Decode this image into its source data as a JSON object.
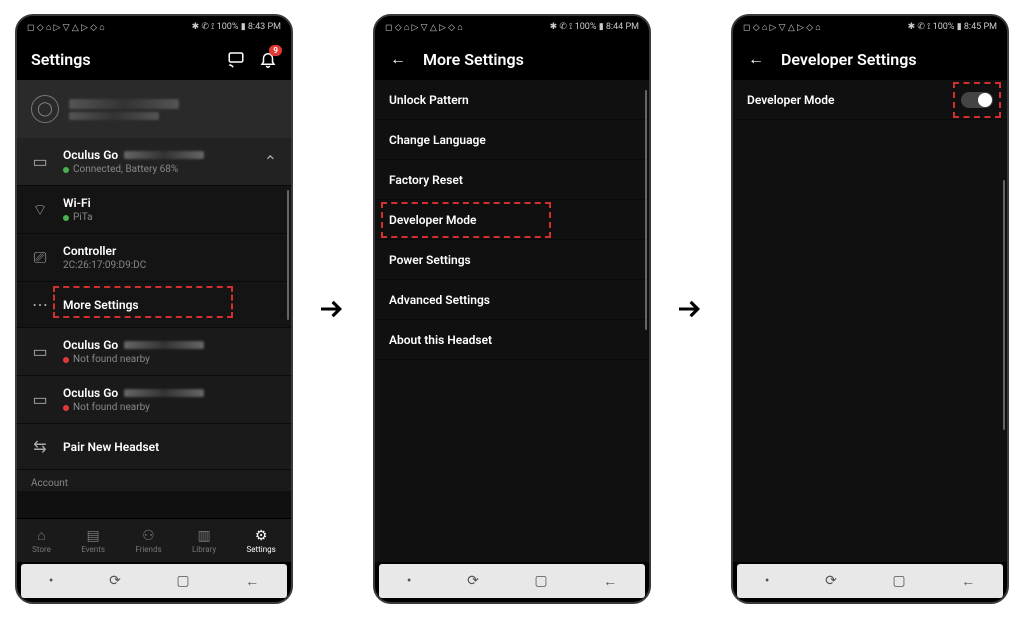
{
  "status": {
    "left_icons": "◻ ◇ ⌂ ▷ ▽ △ ▷ ◇ ⌂",
    "right1": "✱ ✆ ⟟ 100% ▮ 8:43 PM",
    "right2": "✱ ✆ ⟟ 100% ▮ 8:44 PM",
    "right3": "✱ ✆ ⟟ 100% ▮ 8:45 PM",
    "battery_pct": "100%"
  },
  "screen1": {
    "title": "Settings",
    "notif_count": "9",
    "device": {
      "name": "Oculus Go",
      "status": "Connected, Battery 68%"
    },
    "wifi": {
      "label": "Wi-Fi",
      "ssid": "PiTa"
    },
    "controller": {
      "label": "Controller",
      "mac": "2C:26:17:09:D9:DC"
    },
    "more": "More Settings",
    "other1": {
      "name": "Oculus Go",
      "status": "Not found nearby"
    },
    "other2": {
      "name": "Oculus Go",
      "status": "Not found nearby"
    },
    "pair": "Pair New Headset",
    "account": "Account",
    "tabs": {
      "store": "Store",
      "events": "Events",
      "friends": "Friends",
      "library": "Library",
      "settings": "Settings"
    }
  },
  "screen2": {
    "title": "More Settings",
    "items": {
      "unlock": "Unlock Pattern",
      "lang": "Change Language",
      "factory": "Factory Reset",
      "dev": "Developer Mode",
      "power": "Power Settings",
      "advanced": "Advanced Settings",
      "about": "About this Headset"
    }
  },
  "screen3": {
    "title": "Developer Settings",
    "item": "Developer Mode"
  }
}
